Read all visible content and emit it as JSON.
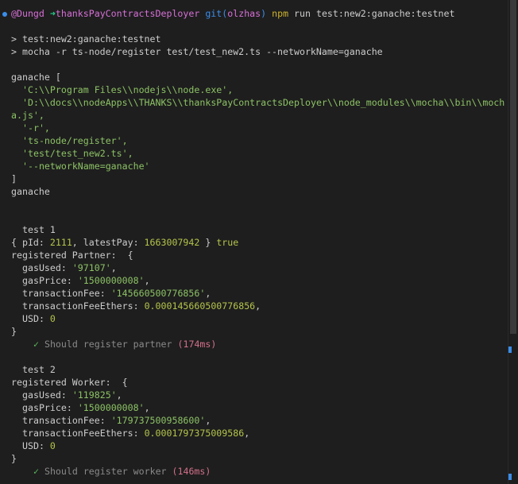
{
  "prompt": {
    "user": "@Dungd",
    "arrow": "➜",
    "dir": "thanksPayContractsDeployer",
    "git_label": "git(",
    "branch": "olzhas",
    "git_close": ")",
    "cmd": "npm",
    "args": "run test:new2:ganache:testnet"
  },
  "npm_output": [
    "> test:new2:ganache:testnet",
    "> mocha -r ts-node/register test/test_new2.ts --networkName=ganache"
  ],
  "argv": {
    "header": "ganache [",
    "items": [
      "'C:\\\\Program Files\\\\nodejs\\\\node.exe',",
      "'D:\\\\docs\\\\nodeApps\\\\THANKS\\\\thanksPayContractsDeployer\\\\node_modules\\\\mocha\\\\bin\\\\moch",
      "'-r',",
      "'ts-node/register',",
      "'test/test_new2.ts',",
      "'--networkName=ganache'"
    ],
    "wrap_tail": "a.js',",
    "close": "]",
    "after": "ganache"
  },
  "test1": {
    "title": "test 1",
    "obj_open": "{ pId: ",
    "pId": "2111",
    "obj_mid": ", latestPay: ",
    "latestPay": "1663007942",
    "obj_close": " } ",
    "bool": "true",
    "reg_label": "registered Partner:  {",
    "fields": {
      "gasUsed_key": "gasUsed: ",
      "gasUsed": "'97107'",
      "gasPrice_key": "gasPrice: ",
      "gasPrice": "'1500000008'",
      "txFee_key": "transactionFee: ",
      "txFee": "'145660500776856'",
      "txFeeEth_key": "transactionFeeEthers: ",
      "txFeeEth": "0.000145660500776856",
      "usd_key": "USD: ",
      "usd": "0"
    },
    "close": "}",
    "check": "✓",
    "pass_text": "Should register partner",
    "duration": "(174ms)"
  },
  "test2": {
    "title": "test 2",
    "reg_label": "registered Worker:  {",
    "fields": {
      "gasUsed_key": "gasUsed: ",
      "gasUsed": "'119825'",
      "gasPrice_key": "gasPrice: ",
      "gasPrice": "'1500000008'",
      "txFee_key": "transactionFee: ",
      "txFee": "'179737500958600'",
      "txFeeEth_key": "transactionFeeEthers: ",
      "txFeeEth": "0.0001797375009586",
      "usd_key": "USD: ",
      "usd": "0"
    },
    "close": "}",
    "check": "✓",
    "pass_text": "Should register worker",
    "duration": "(146ms)"
  },
  "comma": ",",
  "colors": {
    "background": "#1e1e1e",
    "prompt_blue": "#3b8eea",
    "prompt_pink": "#d670d6",
    "string_green": "#8cc265",
    "number_yellow": "#b5c44a",
    "check_green": "#5cb85c",
    "duration_red": "#d2708a"
  }
}
